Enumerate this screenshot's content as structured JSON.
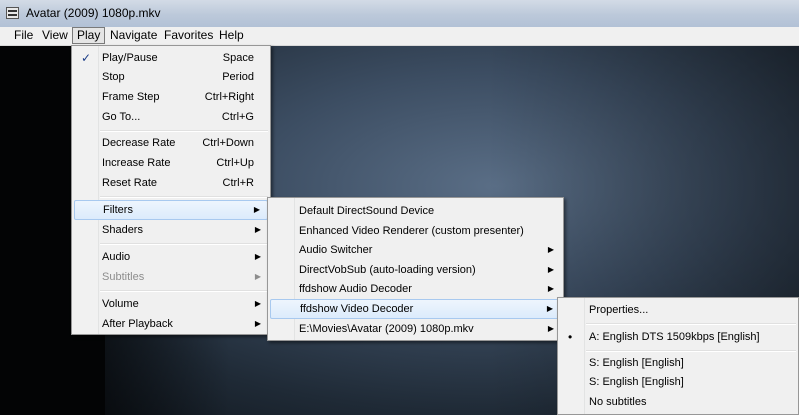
{
  "window": {
    "title": "Avatar (2009) 1080p.mkv"
  },
  "menubar": [
    "File",
    "View",
    "Play",
    "Navigate",
    "Favorites",
    "Help"
  ],
  "play_menu": {
    "items": [
      {
        "label": "Play/Pause",
        "shortcut": "Space",
        "checked": true
      },
      {
        "label": "Stop",
        "shortcut": "Period"
      },
      {
        "label": "Frame Step",
        "shortcut": "Ctrl+Right"
      },
      {
        "label": "Go To...",
        "shortcut": "Ctrl+G"
      },
      {
        "label": "Decrease Rate",
        "shortcut": "Ctrl+Down"
      },
      {
        "label": "Increase Rate",
        "shortcut": "Ctrl+Up"
      },
      {
        "label": "Reset Rate",
        "shortcut": "Ctrl+R"
      },
      {
        "label": "Filters",
        "submenu": true
      },
      {
        "label": "Shaders",
        "submenu": true
      },
      {
        "label": "Audio",
        "submenu": true
      },
      {
        "label": "Subtitles",
        "submenu": true,
        "disabled": true
      },
      {
        "label": "Volume",
        "submenu": true
      },
      {
        "label": "After Playback",
        "submenu": true
      }
    ]
  },
  "filters_menu": {
    "items": [
      {
        "label": "Default DirectSound Device"
      },
      {
        "label": "Enhanced Video Renderer (custom presenter)"
      },
      {
        "label": "Audio Switcher",
        "submenu": true
      },
      {
        "label": "DirectVobSub (auto-loading version)",
        "submenu": true
      },
      {
        "label": "ffdshow Audio Decoder",
        "submenu": true
      },
      {
        "label": "ffdshow Video Decoder",
        "submenu": true
      },
      {
        "label": "E:\\Movies\\Avatar (2009) 1080p.mkv",
        "submenu": true
      }
    ]
  },
  "decoder_menu": {
    "items": [
      {
        "label": "Properties..."
      },
      {
        "label": "A: English DTS 1509kbps [English]",
        "selected": true
      },
      {
        "label": "S: English [English]"
      },
      {
        "label": "S: English [English]"
      },
      {
        "label": "No subtitles"
      }
    ]
  },
  "glyphs": {
    "check": "✓",
    "bullet": "•",
    "arrow": "▶"
  }
}
